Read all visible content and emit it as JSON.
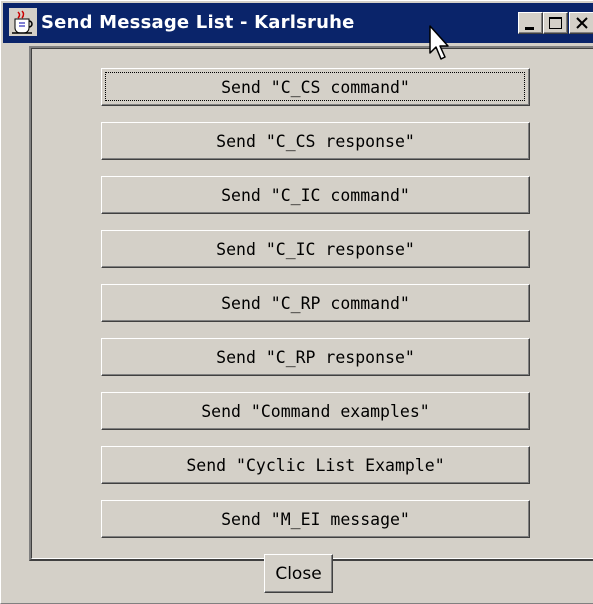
{
  "window": {
    "title": "Send Message List - Karlsruhe",
    "app_icon": "java-cup-icon",
    "controls": [
      "minimize-icon",
      "maximize-icon",
      "close-icon"
    ]
  },
  "message_buttons": [
    "Send \"C_CS command\"",
    "Send \"C_CS response\"",
    "Send \"C_IC command\"",
    "Send \"C_IC response\"",
    "Send \"C_RP command\"",
    "Send \"C_RP response\"",
    "Send \"Command examples\"",
    "Send \"Cyclic List Example\"",
    "Send \"M_EI message\""
  ],
  "focused_button": 0,
  "footer": {
    "close_label": "Close"
  },
  "colors": {
    "titlebar": "#0a246a",
    "face": "#d4d0c8",
    "shadow": "#808080",
    "dark_shadow": "#404040",
    "highlight": "#ffffff"
  }
}
